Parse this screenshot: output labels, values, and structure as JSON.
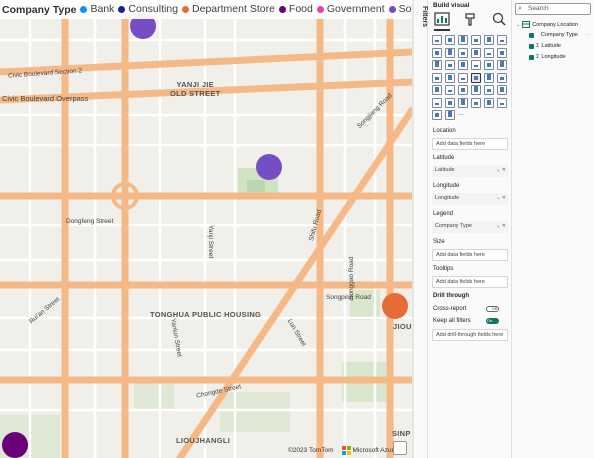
{
  "legend": {
    "title": "Company Type",
    "items": [
      {
        "label": "Bank",
        "color": "#118dff"
      },
      {
        "label": "Consulting",
        "color": "#12239e"
      },
      {
        "label": "Department Store",
        "color": "#e66c37"
      },
      {
        "label": "Food",
        "color": "#6b007b"
      },
      {
        "label": "Government",
        "color": "#e044a7"
      },
      {
        "label": "Software",
        "color": "#744ec2"
      }
    ]
  },
  "map": {
    "labels": {
      "yanji": "YANJI JIE\nOLD STREET",
      "tonghua": "TONGHUA PUBLIC HOUSING",
      "liouj": "LIOUJHANGLI",
      "jiou": "JIOU",
      "sinp": "SINP",
      "civic_section2": "Civic Boulevard Section 2",
      "civic_overpass": "Civic Boulevard Overpass",
      "dongfeng": "Dongfeng Street",
      "songping": "Songping Road",
      "songgao": "Songgao Road",
      "shifu": "Shifu Road",
      "chongde": "Chongde Street",
      "yanji_st": "Yanji Street",
      "songjiang": "Songjiang Road",
      "ruian": "Rui'an Street",
      "lun_street": "Lun Street",
      "yanlun": "Yanlun Street"
    },
    "bubble_colors": {
      "software": "#744ec2",
      "dept": "#e66c37",
      "food": "#6b007b"
    },
    "attribution_tomtom": "©2023 TomTom",
    "attribution_ms": "Microsoft Azure"
  },
  "filters_label": "Filters",
  "viz": {
    "title": "Build visual",
    "fields": [
      {
        "label": "Location",
        "value": "Add data fields here",
        "filled": false
      },
      {
        "label": "Latitude",
        "value": "Latitude",
        "filled": true
      },
      {
        "label": "Longitude",
        "value": "Longitude",
        "filled": true
      },
      {
        "label": "Legend",
        "value": "Company Type",
        "filled": true
      },
      {
        "label": "Size",
        "value": "Add data fields here",
        "filled": false
      },
      {
        "label": "Tooltips",
        "value": "Add data fields here",
        "filled": false
      }
    ],
    "drill": {
      "title": "Drill through",
      "cross_report": "Cross-report",
      "cross_state": "Off",
      "keep_filters": "Keep all filters",
      "keep_state": "On",
      "add": "Add drill-through fields here"
    },
    "more": "..."
  },
  "data": {
    "search_placeholder": "Search",
    "table": "Company Location",
    "fields": [
      "Company Type",
      "Latitude",
      "Longitude"
    ]
  }
}
